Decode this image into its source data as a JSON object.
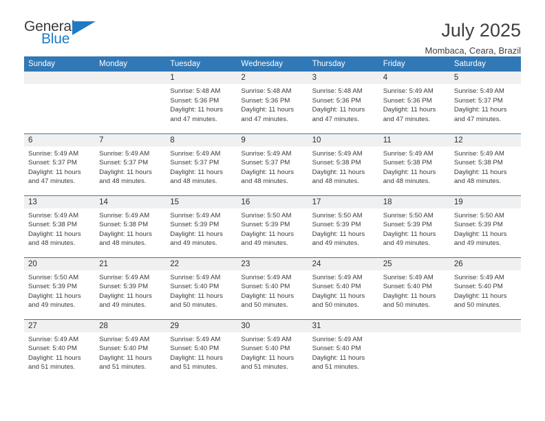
{
  "brand": {
    "name_part1": "General",
    "name_part2": "Blue",
    "accent_color": "#1f7ac4"
  },
  "header": {
    "month_title": "July 2025",
    "location": "Mombaca, Ceara, Brazil",
    "header_bg_color": "#3178b6"
  },
  "calendar": {
    "weekday_headers": [
      "Sunday",
      "Monday",
      "Tuesday",
      "Wednesday",
      "Thursday",
      "Friday",
      "Saturday"
    ],
    "weeks": [
      [
        {
          "day": "",
          "info": ""
        },
        {
          "day": "",
          "info": ""
        },
        {
          "day": "1",
          "info": "Sunrise: 5:48 AM\nSunset: 5:36 PM\nDaylight: 11 hours\nand 47 minutes."
        },
        {
          "day": "2",
          "info": "Sunrise: 5:48 AM\nSunset: 5:36 PM\nDaylight: 11 hours\nand 47 minutes."
        },
        {
          "day": "3",
          "info": "Sunrise: 5:48 AM\nSunset: 5:36 PM\nDaylight: 11 hours\nand 47 minutes."
        },
        {
          "day": "4",
          "info": "Sunrise: 5:49 AM\nSunset: 5:36 PM\nDaylight: 11 hours\nand 47 minutes."
        },
        {
          "day": "5",
          "info": "Sunrise: 5:49 AM\nSunset: 5:37 PM\nDaylight: 11 hours\nand 47 minutes."
        }
      ],
      [
        {
          "day": "6",
          "info": "Sunrise: 5:49 AM\nSunset: 5:37 PM\nDaylight: 11 hours\nand 47 minutes."
        },
        {
          "day": "7",
          "info": "Sunrise: 5:49 AM\nSunset: 5:37 PM\nDaylight: 11 hours\nand 48 minutes."
        },
        {
          "day": "8",
          "info": "Sunrise: 5:49 AM\nSunset: 5:37 PM\nDaylight: 11 hours\nand 48 minutes."
        },
        {
          "day": "9",
          "info": "Sunrise: 5:49 AM\nSunset: 5:37 PM\nDaylight: 11 hours\nand 48 minutes."
        },
        {
          "day": "10",
          "info": "Sunrise: 5:49 AM\nSunset: 5:38 PM\nDaylight: 11 hours\nand 48 minutes."
        },
        {
          "day": "11",
          "info": "Sunrise: 5:49 AM\nSunset: 5:38 PM\nDaylight: 11 hours\nand 48 minutes."
        },
        {
          "day": "12",
          "info": "Sunrise: 5:49 AM\nSunset: 5:38 PM\nDaylight: 11 hours\nand 48 minutes."
        }
      ],
      [
        {
          "day": "13",
          "info": "Sunrise: 5:49 AM\nSunset: 5:38 PM\nDaylight: 11 hours\nand 48 minutes."
        },
        {
          "day": "14",
          "info": "Sunrise: 5:49 AM\nSunset: 5:38 PM\nDaylight: 11 hours\nand 48 minutes."
        },
        {
          "day": "15",
          "info": "Sunrise: 5:49 AM\nSunset: 5:39 PM\nDaylight: 11 hours\nand 49 minutes."
        },
        {
          "day": "16",
          "info": "Sunrise: 5:50 AM\nSunset: 5:39 PM\nDaylight: 11 hours\nand 49 minutes."
        },
        {
          "day": "17",
          "info": "Sunrise: 5:50 AM\nSunset: 5:39 PM\nDaylight: 11 hours\nand 49 minutes."
        },
        {
          "day": "18",
          "info": "Sunrise: 5:50 AM\nSunset: 5:39 PM\nDaylight: 11 hours\nand 49 minutes."
        },
        {
          "day": "19",
          "info": "Sunrise: 5:50 AM\nSunset: 5:39 PM\nDaylight: 11 hours\nand 49 minutes."
        }
      ],
      [
        {
          "day": "20",
          "info": "Sunrise: 5:50 AM\nSunset: 5:39 PM\nDaylight: 11 hours\nand 49 minutes."
        },
        {
          "day": "21",
          "info": "Sunrise: 5:49 AM\nSunset: 5:39 PM\nDaylight: 11 hours\nand 49 minutes."
        },
        {
          "day": "22",
          "info": "Sunrise: 5:49 AM\nSunset: 5:40 PM\nDaylight: 11 hours\nand 50 minutes."
        },
        {
          "day": "23",
          "info": "Sunrise: 5:49 AM\nSunset: 5:40 PM\nDaylight: 11 hours\nand 50 minutes."
        },
        {
          "day": "24",
          "info": "Sunrise: 5:49 AM\nSunset: 5:40 PM\nDaylight: 11 hours\nand 50 minutes."
        },
        {
          "day": "25",
          "info": "Sunrise: 5:49 AM\nSunset: 5:40 PM\nDaylight: 11 hours\nand 50 minutes."
        },
        {
          "day": "26",
          "info": "Sunrise: 5:49 AM\nSunset: 5:40 PM\nDaylight: 11 hours\nand 50 minutes."
        }
      ],
      [
        {
          "day": "27",
          "info": "Sunrise: 5:49 AM\nSunset: 5:40 PM\nDaylight: 11 hours\nand 51 minutes."
        },
        {
          "day": "28",
          "info": "Sunrise: 5:49 AM\nSunset: 5:40 PM\nDaylight: 11 hours\nand 51 minutes."
        },
        {
          "day": "29",
          "info": "Sunrise: 5:49 AM\nSunset: 5:40 PM\nDaylight: 11 hours\nand 51 minutes."
        },
        {
          "day": "30",
          "info": "Sunrise: 5:49 AM\nSunset: 5:40 PM\nDaylight: 11 hours\nand 51 minutes."
        },
        {
          "day": "31",
          "info": "Sunrise: 5:49 AM\nSunset: 5:40 PM\nDaylight: 11 hours\nand 51 minutes."
        },
        {
          "day": "",
          "info": ""
        },
        {
          "day": "",
          "info": ""
        }
      ]
    ]
  }
}
